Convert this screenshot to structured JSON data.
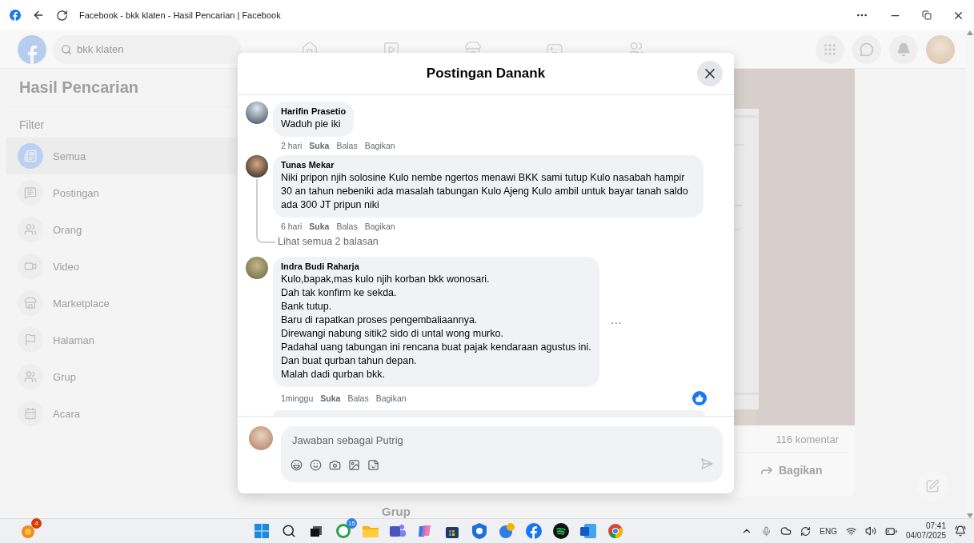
{
  "browser": {
    "title": "Facebook - bkk klaten - Hasil Pencarian | Facebook"
  },
  "header": {
    "search": {
      "value": "bkk klaten"
    },
    "nav": [
      {
        "kind": "home"
      },
      {
        "kind": "video"
      },
      {
        "kind": "store"
      },
      {
        "kind": "gaming"
      },
      {
        "kind": "groups"
      }
    ]
  },
  "sidebar": {
    "title": "Hasil Pencarian",
    "section": "Filter",
    "items": [
      {
        "label": "Semua",
        "kind": "feed",
        "selected": true
      },
      {
        "label": "Postingan",
        "kind": "post",
        "selected": false
      },
      {
        "label": "Orang",
        "kind": "people",
        "selected": false
      },
      {
        "label": "Video",
        "kind": "video",
        "selected": false
      },
      {
        "label": "Marketplace",
        "kind": "store",
        "selected": false
      },
      {
        "label": "Halaman",
        "kind": "flag",
        "selected": false
      },
      {
        "label": "Grup",
        "kind": "group",
        "selected": false
      },
      {
        "label": "Acara",
        "kind": "event",
        "selected": false
      }
    ]
  },
  "post": {
    "comment_count": "116 komentar",
    "share": "Bagikan",
    "next_section": "Grup"
  },
  "modal": {
    "title": "Postingan Danank",
    "comments": [
      {
        "author": "Harifin Prasetio",
        "lines": [
          "Waduh pie iki"
        ],
        "time": "2 hari",
        "actions": [
          "Suka",
          "Balas",
          "Bagikan"
        ],
        "liked": false
      },
      {
        "author": "Tunas Mekar",
        "lines": [
          "Niki pripon njih solosine Kulo nembe ngertos menawi BKK sami tutup Kulo nasabah hampir 30 an tahun nebeniki ada masalah tabungan Kulo Ajeng Kulo ambil untuk bayar tanah saldo ada 300 JT pripun niki"
        ],
        "time": "6 hari",
        "actions": [
          "Suka",
          "Balas",
          "Bagikan"
        ],
        "liked": false,
        "replies": "Lihat semua 2 balasan"
      },
      {
        "author": "Indra Budi Raharja",
        "lines": [
          "Kulo,bapak,mas kulo njih korban bkk wonosari.",
          "Dah tak konfirm ke sekda.",
          "Bank tutup.",
          "Baru di rapatkan proses pengembaliaannya.",
          "Direwangi nabung sitik2 sido di untal wong murko.",
          "Padahal uang tabungan ini rencana buat pajak kendaraan agustus ini.",
          "Dan buat qurban tahun depan.",
          "Malah dadi qurban bkk."
        ],
        "time": "1minggu",
        "actions": [
          "Suka",
          "Balas",
          "Bagikan"
        ],
        "liked": true,
        "more": "···"
      }
    ],
    "composer": {
      "placeholder": "Jawaban sebagai Putrig"
    }
  },
  "taskbar": {
    "weather_badge": "4",
    "apps": [
      {
        "kind": "windows"
      },
      {
        "kind": "search"
      },
      {
        "kind": "taskview"
      },
      {
        "kind": "whatsapp",
        "badge": "15"
      },
      {
        "kind": "folder"
      },
      {
        "kind": "teams"
      },
      {
        "kind": "copilot"
      },
      {
        "kind": "store"
      },
      {
        "kind": "shield"
      },
      {
        "kind": "helper"
      },
      {
        "kind": "facebook"
      },
      {
        "kind": "spotify"
      },
      {
        "kind": "word"
      },
      {
        "kind": "chrome"
      }
    ],
    "language": "ENG",
    "time": "07:41",
    "date": "04/07/2025"
  }
}
